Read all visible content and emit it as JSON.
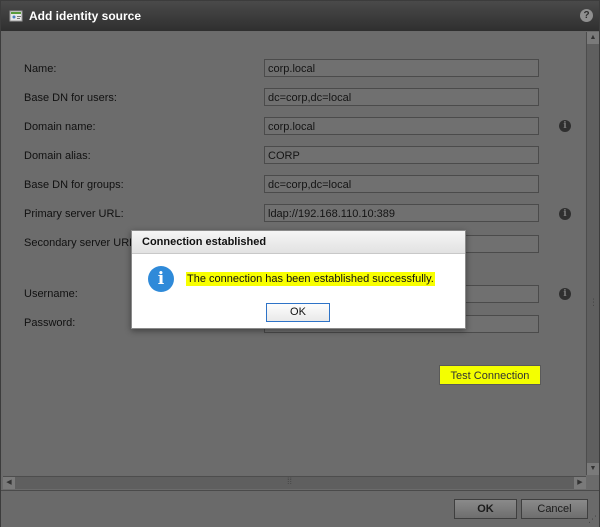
{
  "window": {
    "title": "Add identity source",
    "help_icon": "?"
  },
  "form": {
    "rows": [
      {
        "label": "Name:",
        "value": "corp.local"
      },
      {
        "label": "Base DN for users:",
        "value": "dc=corp,dc=local"
      },
      {
        "label": "Domain name:",
        "value": "corp.local"
      },
      {
        "label": "Domain alias:",
        "value": "CORP"
      },
      {
        "label": "Base DN for groups:",
        "value": "dc=corp,dc=local"
      },
      {
        "label": "Primary server URL:",
        "value": "ldap://192.168.110.10:389"
      },
      {
        "label": "Secondary server URL:",
        "value": ""
      },
      {
        "label": "Username:",
        "value": ""
      },
      {
        "label": "Password:",
        "value": ""
      }
    ],
    "test_connection_label": "Test Connection"
  },
  "footer": {
    "ok_label": "OK",
    "cancel_label": "Cancel"
  },
  "dialog": {
    "title": "Connection established",
    "message": "The connection has been established successfully.",
    "ok_label": "OK"
  },
  "icons": {
    "info_glyph": "i",
    "window_icon": "identity-source-icon"
  },
  "colors": {
    "highlight": "#f4ff00",
    "info_blue": "#2f8ad9"
  }
}
